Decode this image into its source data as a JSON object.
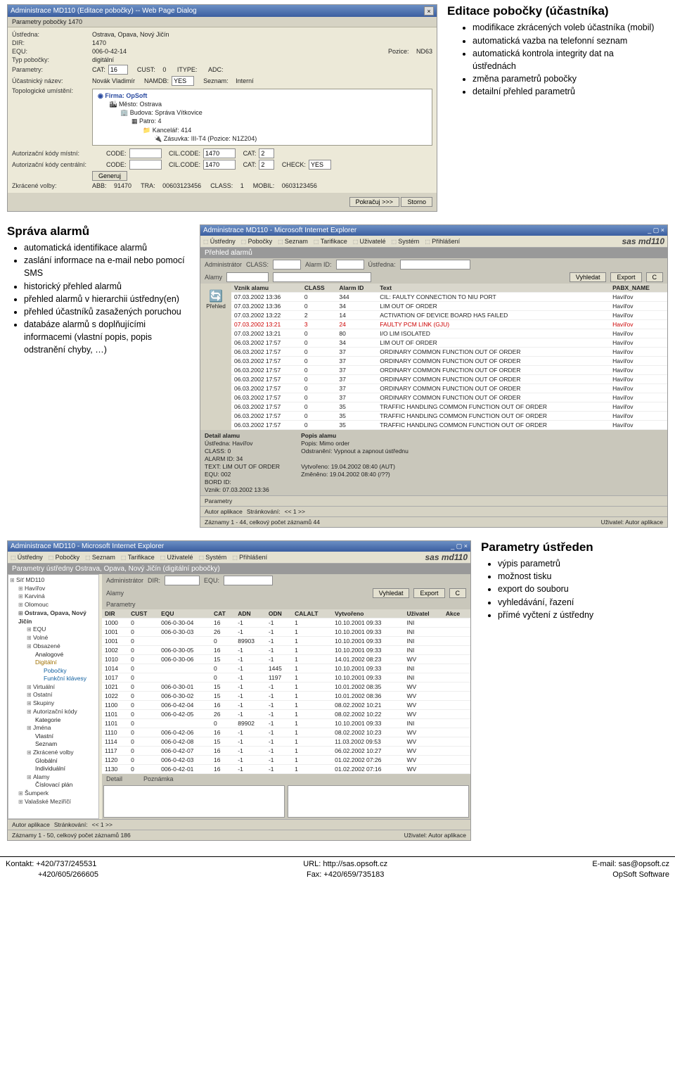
{
  "section1": {
    "title": "Editace pobočky (účastníka)",
    "bullets": [
      "modifikace zkrácených voleb účastníka (mobil)",
      "automatická vazba na telefonní seznam",
      "automatická kontrola integrity dat na ústřednách",
      "změna parametrů pobočky",
      "detailní přehled parametrů"
    ],
    "dialog": {
      "wintitle": "Administrace MD110 (Editace pobočky) -- Web Page Dialog",
      "subtitle": "Parametry pobočky 1470",
      "fields": {
        "ustredna_l": "Ústředna:",
        "ustredna_v": "Ostrava, Opava, Nový Jičín",
        "dir_l": "DIR:",
        "dir_v": "1470",
        "equ_l": "EQU:",
        "equ_v": "006-0-42-14",
        "pozice_l": "Pozice:",
        "pozice_v": "ND63",
        "typ_l": "Typ pobočky:",
        "typ_v": "digitální",
        "param_l": "Parametry:",
        "cat_l": "CAT:",
        "cat_v": "16",
        "cust_l": "CUST:",
        "cust_v": "0",
        "itype_l": "ITYPE:",
        "adc_l": "ADC:",
        "ucn_l": "Účastnický název:",
        "ucn_v": "Novák Vladimír",
        "namdb_l": "NAMDB:",
        "namdb_v": "YES",
        "seznam_l": "Seznam:",
        "seznam_v": "Interní",
        "topo_l": "Topologické umístění:",
        "tree1": "Firma: OpSoft",
        "tree2": "Město: Ostrava",
        "tree3": "Budova: Správa Vítkovice",
        "tree4": "Patro: 4",
        "tree5": "Kancelář: 414",
        "tree6": "Zásuvka: III-T4  (Pozice: N1Z204)",
        "akm_l": "Autorizační kódy místní:",
        "code_l": "CODE:",
        "cilcode_l": "CIL.CODE:",
        "cilcode_v1": "1470",
        "cat2_l": "CAT:",
        "cat2_v": "2",
        "akc_l": "Autorizační kódy centrální:",
        "cilcode_v2": "1470",
        "check_l": "CHECK:",
        "check_v": "YES",
        "gen_btn": "Generuj",
        "zkr_l": "Zkrácené volby:",
        "abb_l": "ABB:",
        "abb_v": "91470",
        "tra_l": "TRA:",
        "tra_v": "00603123456",
        "class_l": "CLASS:",
        "class_v": "1",
        "mobil_l": "MOBIL:",
        "mobil_v": "0603123456",
        "pokracuj": "Pokračuj >>>",
        "storno": "Storno"
      }
    }
  },
  "section2": {
    "title": "Správa alarmů",
    "bullets": [
      "automatická identifikace alarmů",
      "zaslání informace na e-mail nebo pomocí SMS",
      "historický přehled alarmů",
      "přehled alarmů v hierarchii ústředny(en)",
      "přehled účastníků zasažených poruchou",
      "databáze alarmů s doplňujícími informacemi (vlastní popis, popis odstranění chyby, …)"
    ],
    "ie": {
      "wintitle": "Administrace MD110 - Microsoft Internet Explorer",
      "nav": [
        "Ústředny",
        "Pobočky",
        "Seznam",
        "Tarifikace",
        "Uživatelé",
        "Systém",
        "Přihlášení"
      ],
      "brand": "sas md110",
      "panel": "Přehled alarmů",
      "filt_admin": "Administrátor",
      "filt_alarmy": "Alamy",
      "filt_class": "CLASS:",
      "filt_alarmid": "Alarm ID:",
      "filt_ustr": "Ústředna:",
      "btn_vyhledat": "Vyhledat",
      "btn_export": "Export",
      "btn_c": "C",
      "cols": [
        "Vznik alamu",
        "CLASS",
        "Alarm ID",
        "Text",
        "PABX_NAME"
      ],
      "rows": [
        [
          "07.03.2002 13:36",
          "0",
          "344",
          "CIL: FAULTY CONNECTION TO NIU PORT",
          "Havířov"
        ],
        [
          "07.03.2002 13:36",
          "0",
          "34",
          "LIM OUT OF ORDER",
          "Havířov"
        ],
        [
          "07.03.2002 13:22",
          "2",
          "14",
          "ACTIVATION OF DEVICE BOARD HAS FAILED",
          "Havířov"
        ],
        [
          "07.03.2002 13:21",
          "3",
          "24",
          "FAULTY PCM LINK (GJU)",
          "Havířov"
        ],
        [
          "07.03.2002 13:21",
          "0",
          "80",
          "I/O LIM ISOLATED",
          "Havířov"
        ],
        [
          "06.03.2002 17:57",
          "0",
          "34",
          "LIM OUT OF ORDER",
          "Havířov"
        ],
        [
          "06.03.2002 17:57",
          "0",
          "37",
          "ORDINARY COMMON FUNCTION OUT OF ORDER",
          "Havířov"
        ],
        [
          "06.03.2002 17:57",
          "0",
          "37",
          "ORDINARY COMMON FUNCTION OUT OF ORDER",
          "Havířov"
        ],
        [
          "06.03.2002 17:57",
          "0",
          "37",
          "ORDINARY COMMON FUNCTION OUT OF ORDER",
          "Havířov"
        ],
        [
          "06.03.2002 17:57",
          "0",
          "37",
          "ORDINARY COMMON FUNCTION OUT OF ORDER",
          "Havířov"
        ],
        [
          "06.03.2002 17:57",
          "0",
          "37",
          "ORDINARY COMMON FUNCTION OUT OF ORDER",
          "Havířov"
        ],
        [
          "06.03.2002 17:57",
          "0",
          "37",
          "ORDINARY COMMON FUNCTION OUT OF ORDER",
          "Havířov"
        ],
        [
          "06.03.2002 17:57",
          "0",
          "35",
          "TRAFFIC HANDLING COMMON FUNCTION OUT OF ORDER",
          "Havířov"
        ],
        [
          "06.03.2002 17:57",
          "0",
          "35",
          "TRAFFIC HANDLING COMMON FUNCTION OUT OF ORDER",
          "Havířov"
        ],
        [
          "06.03.2002 17:57",
          "0",
          "35",
          "TRAFFIC HANDLING COMMON FUNCTION OUT OF ORDER",
          "Havířov"
        ]
      ],
      "detail_head": "Detail alamu",
      "popis_head": "Popis alamu",
      "d_ustr_l": "Ústředna:",
      "d_ustr_v": "Havířov",
      "d_class_l": "CLASS:",
      "d_class_v": "0",
      "d_aid_l": "ALARM ID:",
      "d_aid_v": "34",
      "d_text_l": "TEXT:",
      "d_text_v": "LIM OUT OF ORDER",
      "d_equ_l": "EQU:",
      "d_equ_v": "002",
      "d_bord_l": "BORD ID:",
      "d_vznik_l": "Vznik:",
      "d_vznik_v": "07.03.2002 13:36",
      "p_popis_l": "Popis:",
      "p_popis_v": "Mimo order",
      "p_odst_l": "Odstranění:",
      "p_odst_v": "Vypnout a zapnout ústřednu",
      "p_vyt_l": "Vytvořeno:",
      "p_vyt_v": "19.04.2002 08:40  (AUT)",
      "p_zme_l": "Změněno:",
      "p_zme_v": "19.04.2002 08:40  (/??)",
      "bot_l": "Parametry",
      "bot_r": "Autor aplikace",
      "pager_l": "Stránkování:",
      "pager_v": "<<  1  >>",
      "recs": "Záznamy 1 - 44, celkový počet záznamů 44",
      "user": "Uživatel: Autor aplikace"
    }
  },
  "section3": {
    "title": "Parametry ústředen",
    "bullets": [
      "výpis parametrů",
      "možnost tisku",
      "export do souboru",
      "vyhledávání, řazení",
      "přímé vyčtení z ústředny"
    ],
    "ie": {
      "wintitle": "Administrace MD110 - Microsoft Internet Explorer",
      "nav": [
        "Ústředny",
        "Pobočky",
        "Seznam",
        "Tarifikace",
        "Uživatelé",
        "Systém",
        "Přihlášení"
      ],
      "brand": "sas md110",
      "panel": "Parametry ústředny Ostrava, Opava, Nový Jičín (digitální pobočky)",
      "filt_admin": "Administrátor",
      "filt_alarmy": "Alamy",
      "filt_param": "Parametry",
      "filt_dir": "DIR:",
      "filt_equ": "EQU:",
      "btn_vyhledat": "Vyhledat",
      "btn_export": "Export",
      "btn_c": "C",
      "tree": {
        "root": "Síť MD110",
        "n1": "Havířov",
        "n2": "Karviná",
        "n3": "Olomouc",
        "n4": "Ostrava, Opava, Nový Jičín",
        "n4a": "EQU",
        "n4b": "Volné",
        "n4c": "Obsazené",
        "n4c1": "Analogové",
        "n4c2": "Digitální",
        "n4c2a": "Pobočky",
        "n4c2b": "Funkční klávesy",
        "n4d": "Virtuální",
        "n4e": "Ostatní",
        "n4f": "Skupiny",
        "n4g": "Autorizační kódy",
        "n4h": "Kategorie",
        "n4i": "Jména",
        "n4i1": "Vlastní",
        "n4i2": "Seznam",
        "n4j": "Zkrácené volby",
        "n4j1": "Globální",
        "n4j2": "Individuální",
        "n4k": "Alamy",
        "n4k1": "Číslovací plán",
        "n5": "Šumperk",
        "n6": "Valašské Meziříčí"
      },
      "cols": [
        "DIR",
        "CUST",
        "EQU",
        "CAT",
        "ADN",
        "ODN",
        "CALALT",
        "Vytvořeno",
        "Uživatel",
        "Akce"
      ],
      "rows": [
        [
          "1000",
          "0",
          "006-0-30-04",
          "16",
          "-1",
          "-1",
          "1",
          "10.10.2001 09:33",
          "INI",
          ""
        ],
        [
          "1001",
          "0",
          "006-0-30-03",
          "26",
          "-1",
          "-1",
          "1",
          "10.10.2001 09:33",
          "INI",
          ""
        ],
        [
          "1001",
          "0",
          "",
          "0",
          "89903",
          "-1",
          "1",
          "10.10.2001 09:33",
          "INI",
          ""
        ],
        [
          "1002",
          "0",
          "006-0-30-05",
          "16",
          "-1",
          "-1",
          "1",
          "10.10.2001 09:33",
          "INI",
          ""
        ],
        [
          "1010",
          "0",
          "006-0-30-06",
          "15",
          "-1",
          "-1",
          "1",
          "14.01.2002 08:23",
          "WV",
          ""
        ],
        [
          "1014",
          "0",
          "",
          "0",
          "-1",
          "1445",
          "1",
          "10.10.2001 09:33",
          "INI",
          ""
        ],
        [
          "1017",
          "0",
          "",
          "0",
          "-1",
          "1197",
          "1",
          "10.10.2001 09:33",
          "INI",
          ""
        ],
        [
          "1021",
          "0",
          "006-0-30-01",
          "15",
          "-1",
          "-1",
          "1",
          "10.01.2002 08:35",
          "WV",
          ""
        ],
        [
          "1022",
          "0",
          "006-0-30-02",
          "15",
          "-1",
          "-1",
          "1",
          "10.01.2002 08:36",
          "WV",
          ""
        ],
        [
          "1100",
          "0",
          "006-0-42-04",
          "16",
          "-1",
          "-1",
          "1",
          "08.02.2002 10:21",
          "WV",
          ""
        ],
        [
          "1101",
          "0",
          "006-0-42-05",
          "26",
          "-1",
          "-1",
          "1",
          "08.02.2002 10:22",
          "WV",
          ""
        ],
        [
          "1101",
          "0",
          "",
          "0",
          "89902",
          "-1",
          "1",
          "10.10.2001 09:33",
          "INI",
          ""
        ],
        [
          "1110",
          "0",
          "006-0-42-06",
          "16",
          "-1",
          "-1",
          "1",
          "08.02.2002 10:23",
          "WV",
          ""
        ],
        [
          "1114",
          "0",
          "006-0-42-08",
          "15",
          "-1",
          "-1",
          "1",
          "11.03.2002 09:53",
          "WV",
          ""
        ],
        [
          "1117",
          "0",
          "006-0-42-07",
          "16",
          "-1",
          "-1",
          "1",
          "06.02.2002 10:27",
          "WV",
          ""
        ],
        [
          "1120",
          "0",
          "006-0-42-03",
          "16",
          "-1",
          "-1",
          "1",
          "01.02.2002 07:26",
          "WV",
          ""
        ],
        [
          "1130",
          "0",
          "006-0-42-01",
          "16",
          "-1",
          "-1",
          "1",
          "01.02.2002 07:16",
          "WV",
          ""
        ]
      ],
      "detail_l": "Detail",
      "pozn_l": "Poznámka",
      "bot_r": "Autor aplikace",
      "pager_l": "Stránkování:",
      "pager_v": "<<  1  >>",
      "recs": "Záznamy 1 - 50, celkový počet záznamů 186",
      "user": "Uživatel: Autor aplikace"
    }
  },
  "footer": {
    "l1": "Kontakt: +420/737/245531",
    "l2": "+420/605/266605",
    "c1": "URL: http://sas.opsoft.cz",
    "c2": "Fax: +420/659/735183",
    "r1": "E-mail: sas@opsoft.cz",
    "r2": "OpSoft Software"
  }
}
